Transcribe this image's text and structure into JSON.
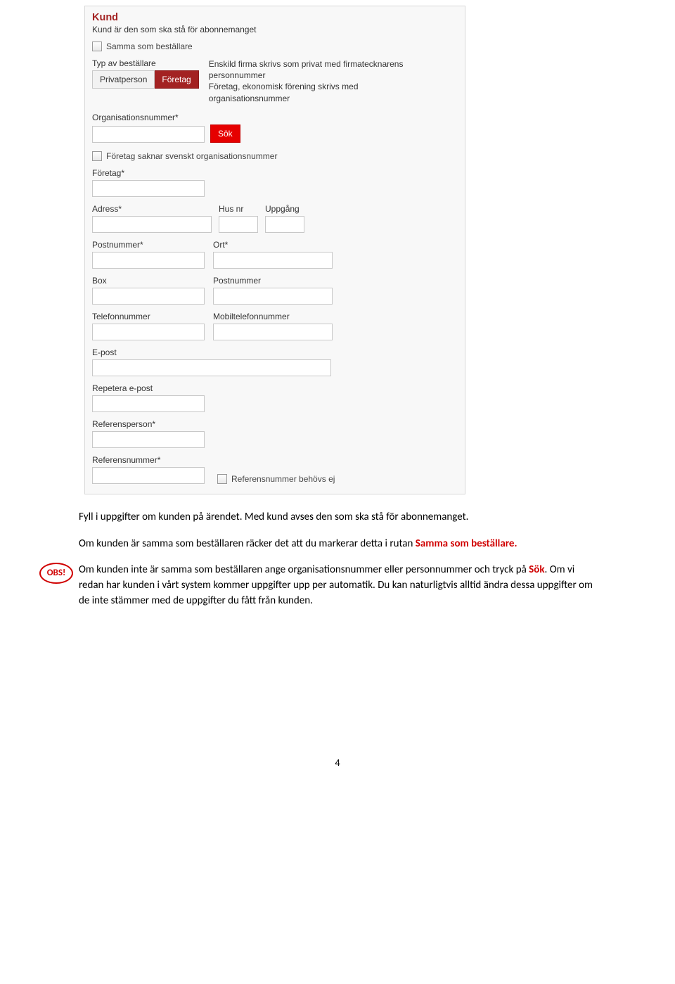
{
  "form": {
    "title": "Kund",
    "subtitle": "Kund är den som ska stå för abonnemanget",
    "same_as_orderer": "Samma som beställare",
    "type_label": "Typ av beställare",
    "type_private": "Privatperson",
    "type_company": "Företag",
    "type_helper1": "Enskild firma skrivs som privat med firmatecknarens personnummer",
    "type_helper2": "Företag, ekonomisk förening skrivs med organisationsnummer",
    "orgnr_label": "Organisationsnummer*",
    "search_btn": "Sök",
    "no_orgnr": "Företag saknar svenskt organisationsnummer",
    "company_label": "Företag*",
    "address_label": "Adress*",
    "husnr_label": "Hus nr",
    "uppgang_label": "Uppgång",
    "postnr_label": "Postnummer*",
    "ort_label": "Ort*",
    "box_label": "Box",
    "box_postnr_label": "Postnummer",
    "tel_label": "Telefonnummer",
    "mobil_label": "Mobiltelefonnummer",
    "email_label": "E-post",
    "email2_label": "Repetera e-post",
    "refperson_label": "Referensperson*",
    "refnr_label": "Referensnummer*",
    "refnr_not_needed": "Referensnummer behövs ej"
  },
  "doc": {
    "p1": "Fyll i uppgifter om kunden på ärendet. Med kund avses den som ska stå för abonnemanget.",
    "p2a": "Om kunden är samma som beställaren räcker det att du markerar detta i rutan ",
    "p2b": "Samma som beställare.",
    "obs": "OBS!",
    "p3a": "Om kunden inte är samma som beställaren ange organisationsnummer eller personnummer och tryck på ",
    "p3b": "Sök",
    "p3c": ". Om vi redan har kunden i vårt system kommer uppgifter upp per automatik. Du kan naturligtvis alltid ändra dessa uppgifter om de inte stämmer med de uppgifter du fått från kunden.",
    "page": "4"
  }
}
